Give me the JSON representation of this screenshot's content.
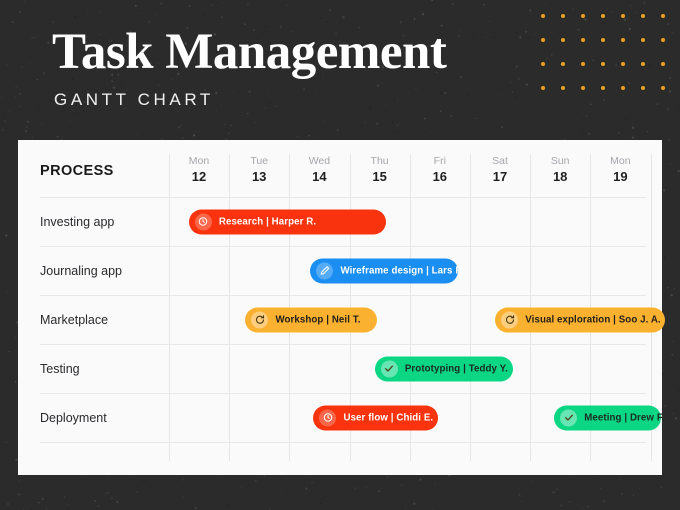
{
  "header": {
    "title": "Task Management",
    "subtitle": "GANTT CHART"
  },
  "theme": {
    "background": "#2b2b2b",
    "card_background": "#fafafa",
    "dot_color": "#e9a21b",
    "title_color": "#ffffff",
    "grid_line": "#e6e6e8"
  },
  "decor": {
    "dot_grid": {
      "columns": 7,
      "rows": 4
    }
  },
  "table": {
    "process_header": "PROCESS",
    "days": [
      {
        "name": "Mon",
        "date": "12"
      },
      {
        "name": "Tue",
        "date": "13"
      },
      {
        "name": "Wed",
        "date": "14"
      },
      {
        "name": "Thu",
        "date": "15"
      },
      {
        "name": "Fri",
        "date": "16"
      },
      {
        "name": "Sat",
        "date": "17"
      },
      {
        "name": "Sun",
        "date": "18"
      },
      {
        "name": "Mon",
        "date": "19"
      }
    ],
    "rows": [
      {
        "label": "Investing app"
      },
      {
        "label": "Journaling app"
      },
      {
        "label": "Marketplace"
      },
      {
        "label": "Testing"
      },
      {
        "label": "Deployment"
      }
    ]
  },
  "chart_data": {
    "type": "gantt",
    "title": "Task Management",
    "subtitle": "GANTT CHART",
    "xlabel": "",
    "ylabel": "PROCESS",
    "categories": [
      "Investing app",
      "Journaling app",
      "Marketplace",
      "Testing",
      "Deployment"
    ],
    "x_ticks": [
      "Mon 12",
      "Tue 13",
      "Wed 14",
      "Thu 15",
      "Fri 16",
      "Sat 17",
      "Sun 18",
      "Mon 19"
    ],
    "grid": true,
    "legend": "none",
    "tasks": [
      {
        "row": "Investing app",
        "task": "Research",
        "owner": "Harper R.",
        "label": "Research | Harper R.",
        "icon": "clock-icon",
        "start_day": "Mon 12",
        "end_day": "Wed 14",
        "start": 0.33,
        "span": 3.28,
        "color": "#f8330d",
        "text_color": "#ffffff"
      },
      {
        "row": "Journaling app",
        "task": "Wireframe design",
        "owner": "Lars P.",
        "label": "Wireframe design | Lars P.",
        "icon": "pencil-icon",
        "start_day": "Wed 14",
        "end_day": "Fri 16",
        "start": 2.35,
        "span": 2.45,
        "color": "#1b8ef2",
        "text_color": "#ffffff"
      },
      {
        "row": "Marketplace",
        "task": "Workshop",
        "owner": "Neil T.",
        "label": "Workshop | Neil T.",
        "icon": "refresh-icon",
        "start_day": "Tue 13",
        "end_day": "Thu 15",
        "start": 1.27,
        "span": 2.18,
        "color": "#fbb130",
        "text_color": "#23201a"
      },
      {
        "row": "Marketplace",
        "task": "Visual exploration",
        "owner": "Soo J. A.",
        "label": "Visual exploration | Soo J. A.",
        "icon": "refresh-icon",
        "start_day": "Sat 17",
        "end_day": "Mon 19",
        "start": 5.42,
        "span": 2.82,
        "color": "#fbb130",
        "text_color": "#23201a"
      },
      {
        "row": "Testing",
        "task": "Prototyping",
        "owner": "Teddy Y.",
        "label": "Prototyping | Teddy Y.",
        "icon": "check-icon",
        "start_day": "Thu 15",
        "end_day": "Sat 17",
        "start": 3.42,
        "span": 2.3,
        "color": "#0bd683",
        "text_color": "#1b2b22"
      },
      {
        "row": "Deployment",
        "task": "User flow",
        "owner": "Chidi E.",
        "label": "User flow | Chidi E.",
        "icon": "clock-icon",
        "start_day": "Wed 14",
        "end_day": "Fri 16",
        "start": 2.4,
        "span": 2.07,
        "color": "#f8330d",
        "text_color": "#ffffff"
      },
      {
        "row": "Deployment",
        "task": "Meeting",
        "owner": "Drew F.",
        "label": "Meeting | Drew F.",
        "icon": "check-icon",
        "start_day": "Sun 18",
        "end_day": "Mon 19",
        "start": 6.4,
        "span": 1.77,
        "color": "#0bd683",
        "text_color": "#1b2b22"
      }
    ]
  }
}
